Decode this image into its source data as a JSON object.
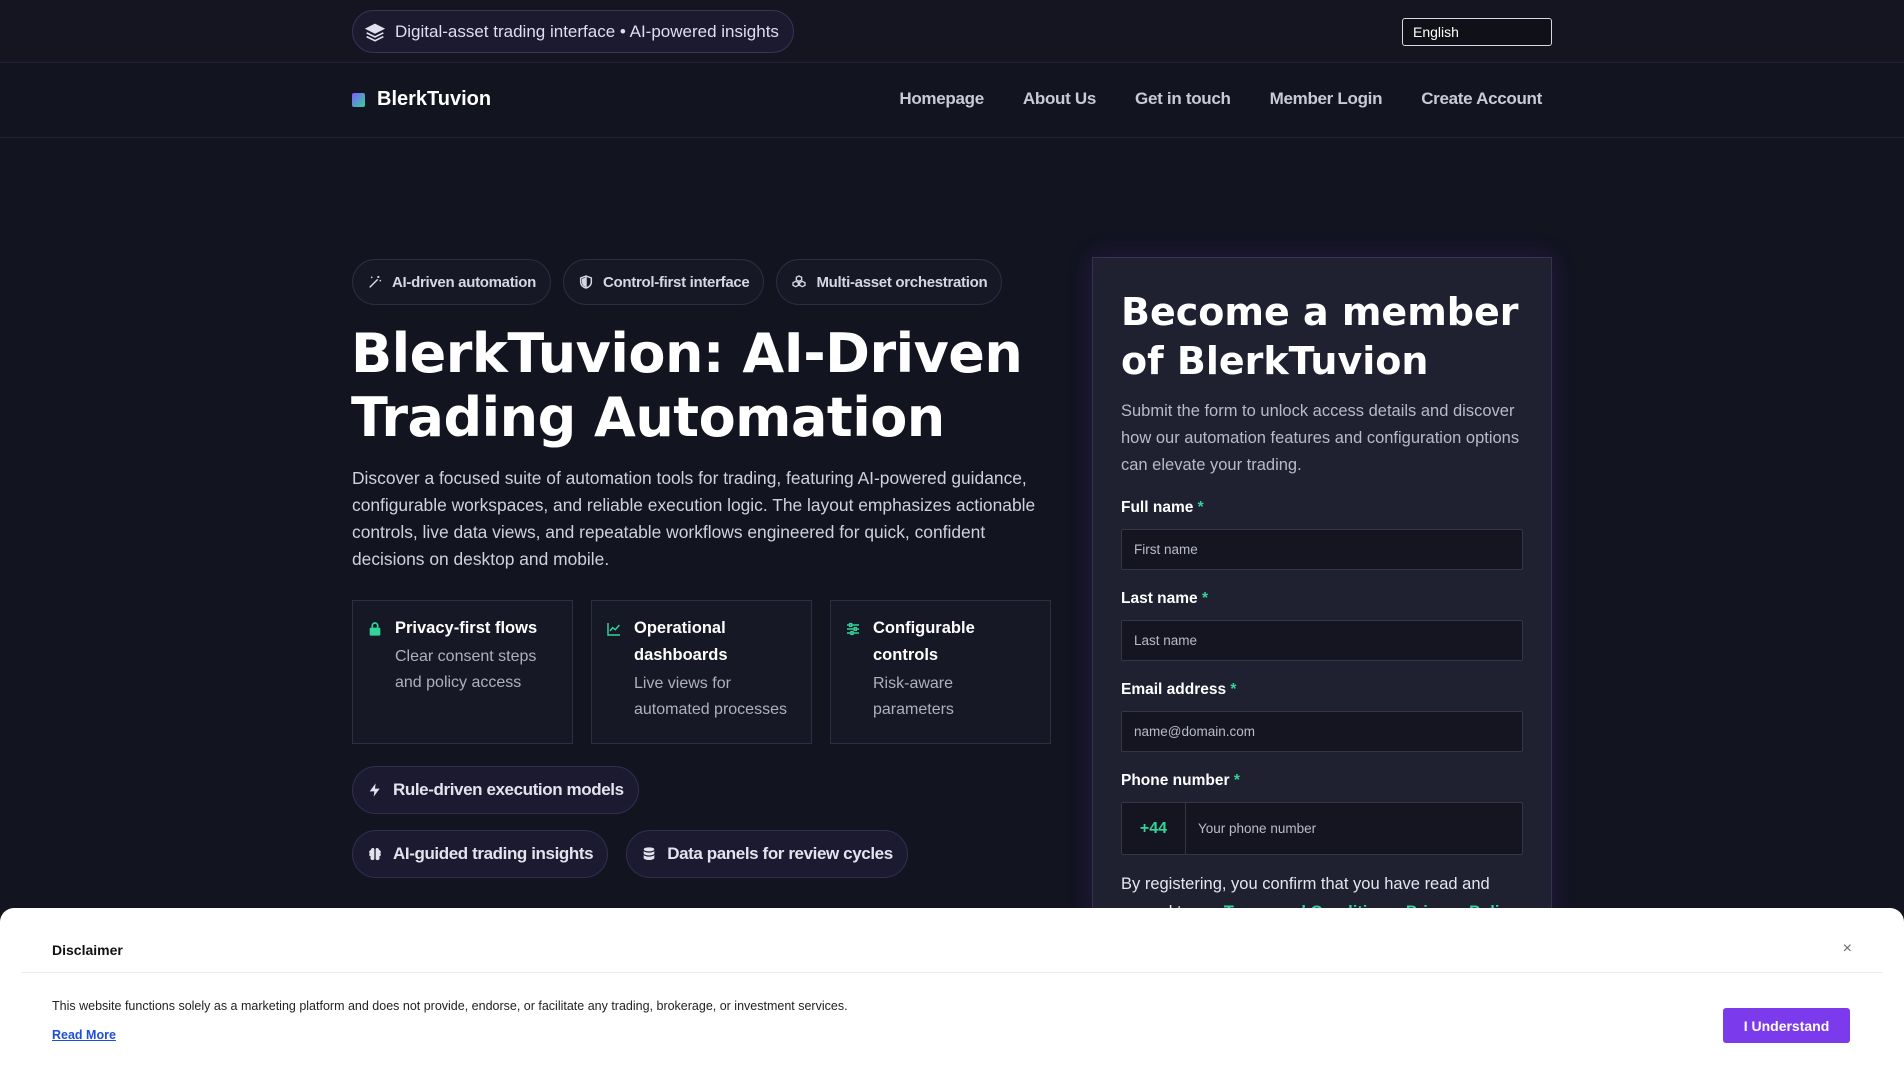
{
  "topbar": {
    "tagline": "Digital-asset trading interface • AI-powered insights",
    "language": "English"
  },
  "nav": {
    "brand": "BlerkTuvion",
    "links": [
      "Homepage",
      "About Us",
      "Get in touch",
      "Member Login",
      "Create Account"
    ]
  },
  "hero": {
    "badges": [
      "AI-driven automation",
      "Control-first interface",
      "Multi-asset orchestration"
    ],
    "title": "BlerkTuvion: AI-Driven Trading Automation",
    "description": "Discover a focused suite of automation tools for trading, featuring AI-powered guidance, configurable workspaces, and reliable execution logic. The layout emphasizes actionable controls, live data views, and repeatable workflows engineered for quick, confident decisions on desktop and mobile.",
    "features": [
      {
        "title": "Privacy-first flows",
        "sub": "Clear consent steps and policy access",
        "icon": "lock-icon"
      },
      {
        "title": "Operational dashboards",
        "sub": "Live views for automated processes",
        "icon": "chart-line-icon"
      },
      {
        "title": "Configurable controls",
        "sub": "Risk-aware parameters",
        "icon": "sliders-icon"
      }
    ],
    "chips": [
      "Rule-driven execution models",
      "AI-guided trading insights",
      "Data panels for review cycles"
    ]
  },
  "form": {
    "title": "Become a member of BlerkTuvion",
    "description": "Submit the form to unlock access details and discover how our automation features and configuration options can elevate your trading.",
    "full_name_label": "Full name",
    "first_name_placeholder": "First name",
    "last_name_label": "Last name",
    "last_name_placeholder": "Last name",
    "email_label": "Email address",
    "email_placeholder": "name@domain.com",
    "phone_label": "Phone number",
    "phone_code": "+44",
    "phone_placeholder": "Your phone number",
    "required_mark": "*",
    "consent_text": "By registering, you confirm that you have read and agreed to our ",
    "terms_link": "Terms and Conditions",
    "separator": ", ",
    "privacy_link": "Privacy Policy"
  },
  "disclaimer": {
    "title": "Disclaimer",
    "close": "×",
    "text": "This website functions solely as a marketing platform and does not provide, endorse, or facilitate any trading, brokerage, or investment services.",
    "read_more": "Read More",
    "button": "I Understand"
  },
  "colors": {
    "accent_green": "#34d399",
    "accent_purple": "#7c3aed",
    "background": "#121420"
  }
}
